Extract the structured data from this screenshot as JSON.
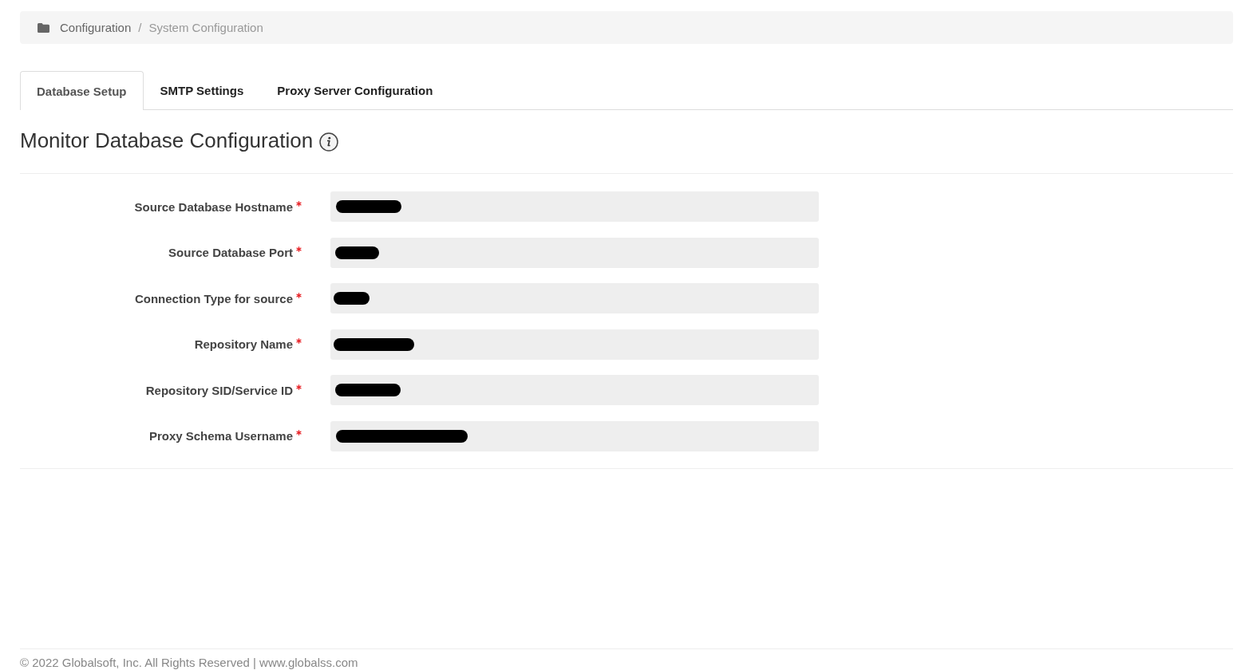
{
  "breadcrumb": {
    "separator": "/",
    "items": [
      {
        "label": "Configuration",
        "current": false
      },
      {
        "label": "System Configuration",
        "current": true
      }
    ]
  },
  "tabs": [
    {
      "label": "Database Setup",
      "selected": true
    },
    {
      "label": "SMTP Settings",
      "selected": false
    },
    {
      "label": "Proxy Server Configuration",
      "selected": false
    }
  ],
  "section": {
    "title": "Monitor Database Configuration",
    "info": true
  },
  "fields": [
    {
      "label": "Source Database Hostname",
      "required": true,
      "redacted": true
    },
    {
      "label": "Source Database Port",
      "required": true,
      "redacted": true
    },
    {
      "label": "Connection Type for source",
      "required": true,
      "redacted": true
    },
    {
      "label": "Repository Name",
      "required": true,
      "redacted": true
    },
    {
      "label": "Repository SID/Service ID",
      "required": true,
      "redacted": true
    },
    {
      "label": "Proxy Schema Username",
      "required": true,
      "redacted": true
    }
  ],
  "footer": {
    "text": "© 2022 Globalsoft, Inc. All Rights Reserved | www.globalss.com"
  }
}
